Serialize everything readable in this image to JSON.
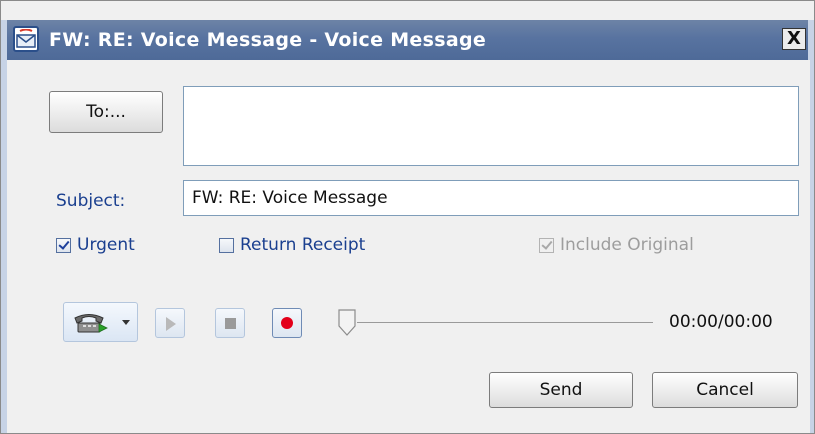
{
  "window": {
    "title": "FW:  RE:  Voice Message - Voice Message",
    "close_glyph": "X"
  },
  "icons": {
    "window": "voice-message-envelope-icon",
    "phone": "telephone-icon",
    "dropdown": "chevron-down-icon",
    "play": "play-icon",
    "stop": "stop-icon",
    "record": "record-icon"
  },
  "form": {
    "to_button_label": "To:...",
    "to_value": "",
    "subject_label": "Subject:",
    "subject_value": "FW:  RE:  Voice Message"
  },
  "options": {
    "urgent": {
      "label": "Urgent",
      "checked": true,
      "enabled": true
    },
    "return_receipt": {
      "label": "Return Receipt",
      "checked": false,
      "enabled": true
    },
    "include_original": {
      "label": "Include Original",
      "checked": true,
      "enabled": false
    }
  },
  "player": {
    "time": "00:00/00:00",
    "position": 0
  },
  "actions": {
    "send_label": "Send",
    "cancel_label": "Cancel"
  },
  "colors": {
    "titlebar": "#5873a0",
    "label_blue": "#1a3f8f",
    "record_red": "#e3001b",
    "field_border": "#7f9db9"
  }
}
